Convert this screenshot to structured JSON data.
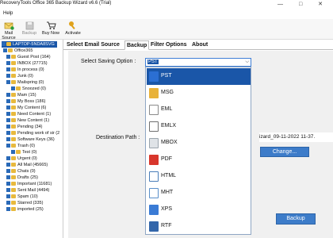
{
  "window": {
    "title": "RecoveryTools Office 365 Backup Wizard v6.6 (Trial)",
    "controls": "— □ ✕"
  },
  "menu": {
    "help_label": "Help"
  },
  "toolbar": {
    "buttons": [
      {
        "label": "Mail Source",
        "icon": "mail-source-icon"
      },
      {
        "label": "Backup",
        "icon": "backup-icon"
      },
      {
        "label": "Buy Now",
        "icon": "cart-icon"
      },
      {
        "label": "Activate",
        "icon": "key-icon"
      }
    ]
  },
  "tree": [
    {
      "label": "LAPTOP-5NDA8SVG",
      "selected": true,
      "checked": true
    },
    {
      "label": "Office365",
      "checked": true
    },
    {
      "label": "Guest Post (164)",
      "checked": true
    },
    {
      "label": "INBOX (27715)",
      "checked": true
    },
    {
      "label": "In process (0)",
      "checked": true
    },
    {
      "label": "Junk (0)",
      "checked": true
    },
    {
      "label": "Mailspring (0)",
      "checked": true
    },
    {
      "label": "Snoozed (0)",
      "checked": true
    },
    {
      "label": "Mam (15)",
      "checked": true
    },
    {
      "label": "My Boss (186)",
      "checked": true
    },
    {
      "label": "My Content (6)",
      "checked": true
    },
    {
      "label": "Need Content (1)",
      "checked": true
    },
    {
      "label": "New Content (1)",
      "checked": true
    },
    {
      "label": "Pending (34)",
      "checked": true
    },
    {
      "label": "Pending work of sir (2",
      "checked": true
    },
    {
      "label": "Software Keys (36)",
      "checked": true
    },
    {
      "label": "Trash (0)",
      "checked": true
    },
    {
      "label": "Test (0)",
      "checked": true
    },
    {
      "label": "Urgent (0)",
      "checked": true
    },
    {
      "label": "All Mail (45665)",
      "checked": true
    },
    {
      "label": "Chats (0)",
      "checked": true
    },
    {
      "label": "Drafts (25)",
      "checked": true
    },
    {
      "label": "Important (11681)",
      "checked": true
    },
    {
      "label": "Sent Mail (4494)",
      "checked": true
    },
    {
      "label": "Spam (10)",
      "checked": true
    },
    {
      "label": "Starred (335)",
      "checked": true
    },
    {
      "label": "imported (25)",
      "checked": true
    }
  ],
  "tabs": [
    "Select Email Source",
    "Backup",
    "Filter Options",
    "About"
  ],
  "form": {
    "saving_option_label": "Select Saving Option :",
    "saving_option_value": "PST",
    "destination_label": "Destination Path :",
    "destination_value": "izard_09-11-2022 11-37.",
    "change_label": "Change...",
    "backup_label": "Backup"
  },
  "options": [
    {
      "label": "PST",
      "icon": "pst-file-icon",
      "color": "#2b6fd3"
    },
    {
      "label": "MSG",
      "icon": "msg-file-icon",
      "color": "#e8b23a"
    },
    {
      "label": "EML",
      "icon": "eml-file-icon",
      "color": "#8a8a8a"
    },
    {
      "label": "EMLX",
      "icon": "emlx-file-icon",
      "color": "#707070"
    },
    {
      "label": "MBOX",
      "icon": "mbox-file-icon",
      "color": "#9aa4ad"
    },
    {
      "label": "PDF",
      "icon": "pdf-file-icon",
      "color": "#d8362c"
    },
    {
      "label": "HTML",
      "icon": "html-file-icon",
      "color": "#4a7db8"
    },
    {
      "label": "MHT",
      "icon": "mht-file-icon",
      "color": "#5a8fc9"
    },
    {
      "label": "XPS",
      "icon": "xps-file-icon",
      "color": "#3a7bd5"
    },
    {
      "label": "RTF",
      "icon": "rtf-file-icon",
      "color": "#3366aa"
    }
  ]
}
